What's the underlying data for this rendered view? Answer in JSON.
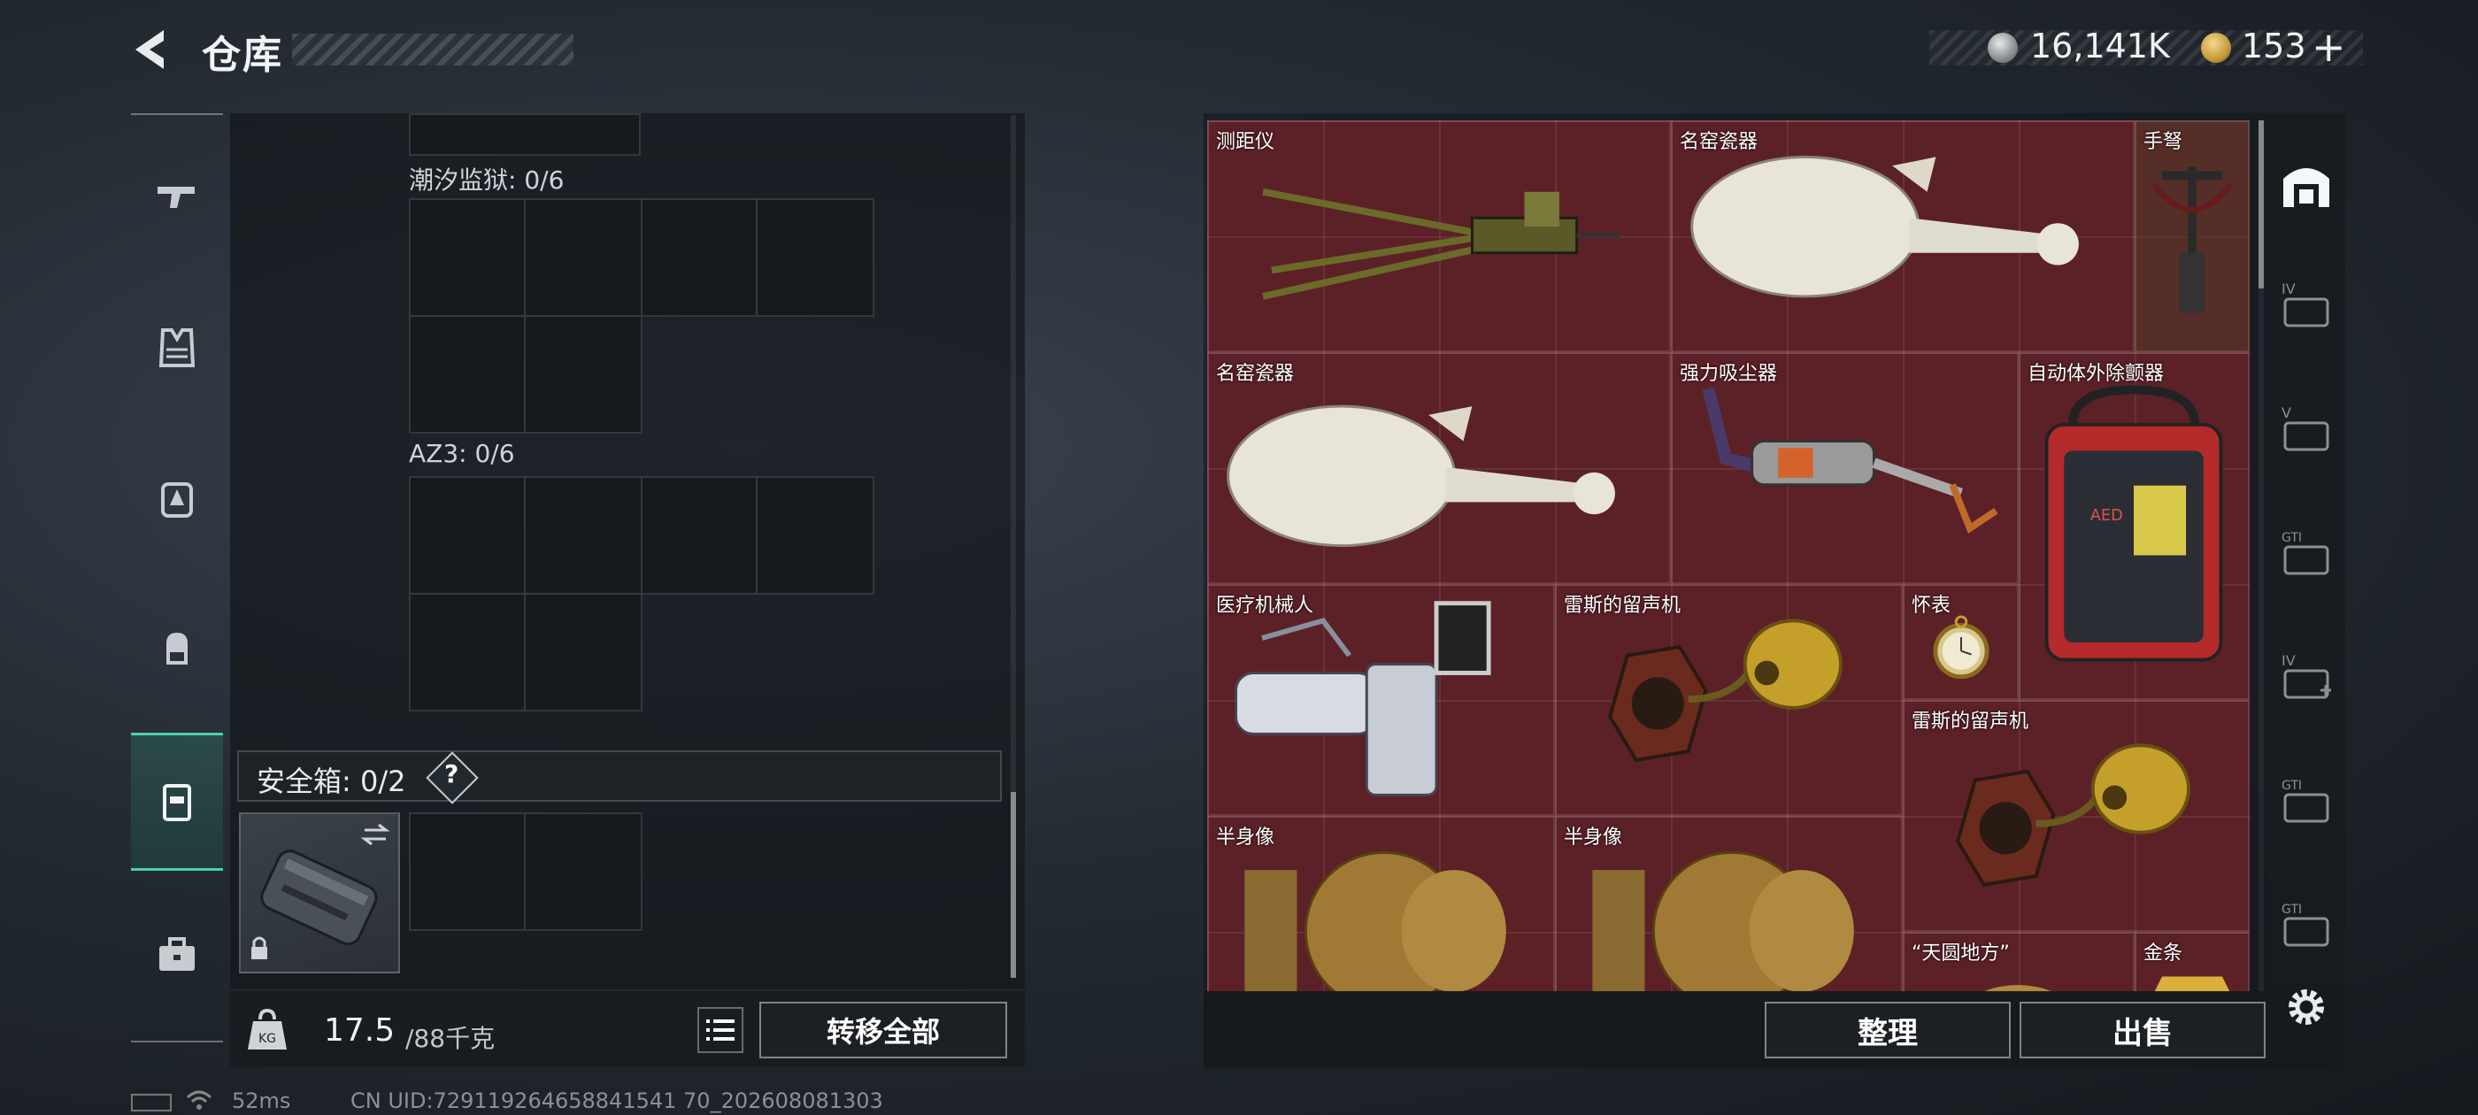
{
  "header": {
    "title": "仓库"
  },
  "currency": {
    "coin1_value": "16,141K",
    "coin2_value": "153",
    "plus": "+"
  },
  "categories": [
    {
      "name": "weapons"
    },
    {
      "name": "armor"
    },
    {
      "name": "chest-rig"
    },
    {
      "name": "backpack"
    },
    {
      "name": "safebox",
      "selected": true
    },
    {
      "name": "case"
    }
  ],
  "container": {
    "sections": [
      {
        "label": "潮汐监狱: 0/6"
      },
      {
        "label": "AZ3: 0/6"
      }
    ],
    "safebox": {
      "label": "安全箱: 0/2",
      "help": "?"
    }
  },
  "footer_left": {
    "weight": "17.5",
    "weight_max": "/88千克",
    "transfer_all": "转移全部"
  },
  "stash_items": [
    {
      "name": "测距仪"
    },
    {
      "name": "名窑瓷器"
    },
    {
      "name": "手弩"
    },
    {
      "name": "名窑瓷器"
    },
    {
      "name": "强力吸尘器"
    },
    {
      "name": "自动体外除颤器"
    },
    {
      "name": "医疗机械人"
    },
    {
      "name": "雷斯的留声机"
    },
    {
      "name": "怀表"
    },
    {
      "name": "雷斯的留声机"
    },
    {
      "name": "半身像"
    },
    {
      "name": "半身像"
    },
    {
      "name": "“天圆地方”"
    },
    {
      "name": "金条"
    }
  ],
  "footer_right": {
    "sort": "整理",
    "sell": "出售"
  },
  "side_tabs": [
    {
      "name": "stash-main",
      "selected": true
    },
    {
      "name": "IV"
    },
    {
      "name": "V"
    },
    {
      "name": "GTI"
    },
    {
      "name": "IV+"
    },
    {
      "name": "GTI-2"
    },
    {
      "name": "GTI-3"
    }
  ],
  "status": {
    "ping": "52ms",
    "uid": "CN UID:729119264658841541 70_202608081303"
  },
  "colors": {
    "accent": "#4ad2a8",
    "grid_bg": "#5b2127"
  }
}
